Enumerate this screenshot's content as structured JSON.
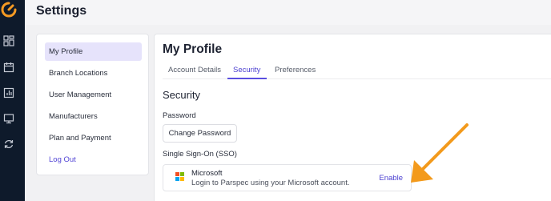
{
  "header": {
    "title": "Settings"
  },
  "rail": {
    "icons": [
      "dashboard-icon",
      "calendar-icon",
      "chart-icon",
      "monitor-icon",
      "refresh-icon"
    ]
  },
  "menu": {
    "items": [
      {
        "label": "My Profile",
        "active": true
      },
      {
        "label": "Branch Locations"
      },
      {
        "label": "User Management"
      },
      {
        "label": "Manufacturers"
      },
      {
        "label": "Plan and Payment"
      },
      {
        "label": "Log Out"
      }
    ]
  },
  "profile": {
    "title": "My Profile",
    "tabs": [
      {
        "label": "Account Details"
      },
      {
        "label": "Security",
        "active": true
      },
      {
        "label": "Preferences"
      }
    ],
    "section_title": "Security",
    "password_label": "Password",
    "change_password_button": "Change Password",
    "sso_label": "Single Sign-On (SSO)",
    "sso": {
      "provider": "Microsoft",
      "description": "Login to Parspec using your Microsoft account.",
      "action": "Enable"
    }
  },
  "colors": {
    "rail_bg": "#0e1a2b",
    "logo_accent": "#f59a23",
    "primary": "#4b3fd0",
    "active_menu_bg": "#e6e3fb",
    "annotation_arrow": "#f39a1c"
  }
}
